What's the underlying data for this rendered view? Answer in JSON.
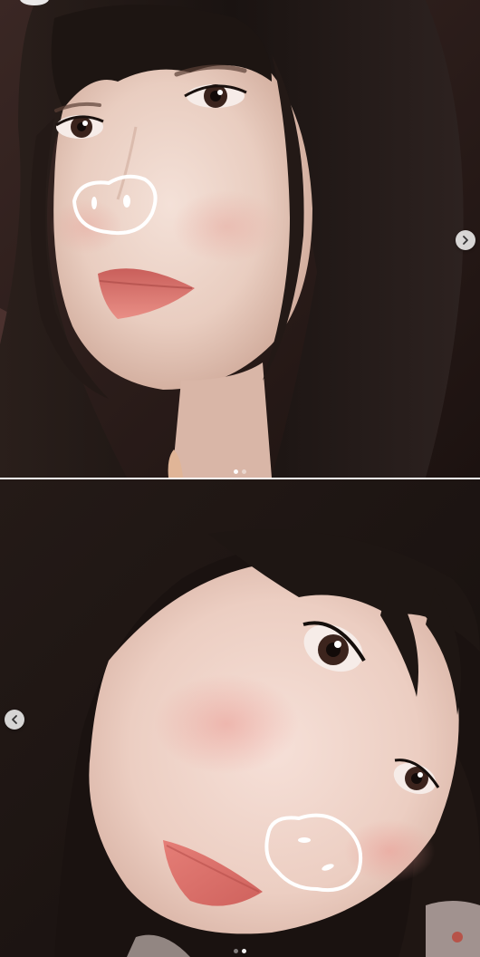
{
  "post": {
    "slides": [
      {
        "id": "slide-1",
        "sticker": "pig-nose-doodle",
        "nav_icon": "chevron-right-icon",
        "active_index": 0,
        "total": 2
      },
      {
        "id": "slide-2",
        "sticker": "pig-nose-doodle",
        "nav_icon": "chevron-left-icon",
        "active_index": 1,
        "total": 2
      }
    ],
    "colors": {
      "hair": "#1e1613",
      "skin": "#ecd2c6",
      "lips": "#d8706a",
      "background_dark": "#2a1d1b",
      "doodle": "#ffffff"
    }
  }
}
